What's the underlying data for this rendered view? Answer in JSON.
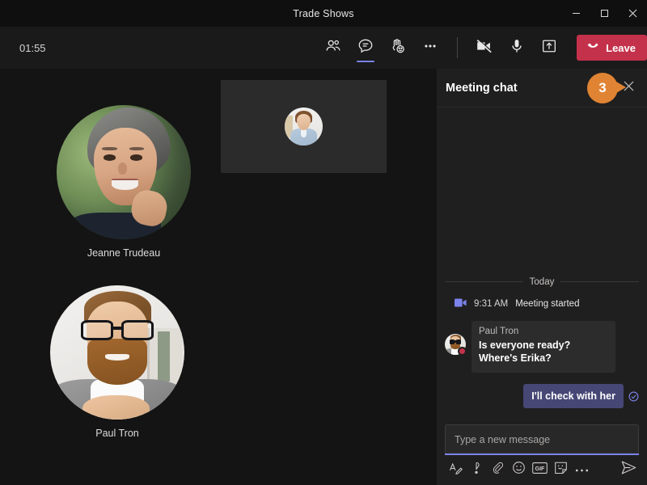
{
  "window": {
    "title": "Trade Shows",
    "controls": {
      "minimize": "minimize-button",
      "maximize": "maximize-button",
      "close": "close-button"
    }
  },
  "toolbar": {
    "timer": "01:55",
    "items": [
      {
        "icon": "people-icon",
        "label": "People",
        "active": false
      },
      {
        "icon": "chat-icon",
        "label": "Chat",
        "active": true
      },
      {
        "icon": "raise-hand-reactions-icon",
        "label": "Reactions",
        "active": false
      },
      {
        "icon": "more-options-icon",
        "label": "More actions",
        "active": false
      },
      {
        "icon": "camera-off-icon",
        "label": "Camera off",
        "active": false
      },
      {
        "icon": "microphone-icon",
        "label": "Mic",
        "active": false
      },
      {
        "icon": "share-screen-icon",
        "label": "Share",
        "active": false
      }
    ],
    "leave_label": "Leave",
    "leave_icon": "hang-up-icon",
    "leave_color": "#c4314b"
  },
  "stage": {
    "participants": [
      {
        "name": "Jeanne Trudeau",
        "tile": "circle-video"
      },
      {
        "name": "Paul Tron",
        "tile": "circle-video"
      },
      {
        "name": "",
        "tile": "rect-avatar"
      }
    ]
  },
  "chat": {
    "title": "Meeting chat",
    "close_icon": "close-icon",
    "callout": {
      "number": "3",
      "color": "#e08434"
    },
    "day_divider": "Today",
    "system_message": {
      "icon": "video-camera-icon",
      "icon_color": "#7b83eb",
      "time": "9:31 AM",
      "text": "Meeting started"
    },
    "messages": [
      {
        "direction": "incoming",
        "author": "Paul Tron",
        "text": "Is everyone ready? Where's Erika?",
        "presence": "busy",
        "presence_color": "#c4314b"
      },
      {
        "direction": "outgoing",
        "text": "I'll check with her",
        "bubble_color": "#464775",
        "status_icon": "delivered-check-icon"
      }
    ],
    "compose": {
      "placeholder": "Type a new message",
      "value": "",
      "actions": [
        {
          "icon": "format-text-icon",
          "label": "Format"
        },
        {
          "icon": "priority-icon",
          "label": "Set delivery options"
        },
        {
          "icon": "attach-file-icon",
          "label": "Attach"
        },
        {
          "icon": "emoji-icon",
          "label": "Emoji"
        },
        {
          "icon": "gif-icon",
          "label": "Giphy"
        },
        {
          "icon": "sticker-icon",
          "label": "Sticker"
        },
        {
          "icon": "more-options-icon",
          "label": "More options"
        },
        {
          "icon": "send-icon",
          "label": "Send"
        }
      ]
    }
  }
}
